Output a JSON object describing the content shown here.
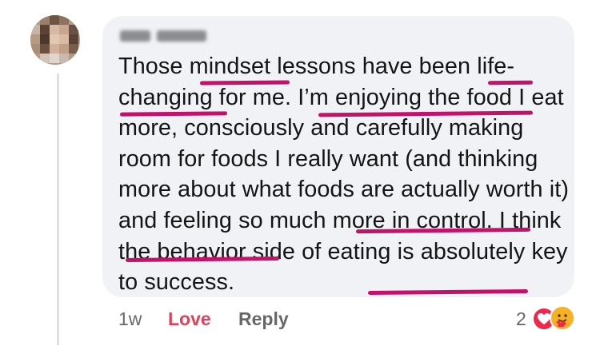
{
  "comment": {
    "author_name": "",
    "paragraph": "Those mindset lessons have been life-changing for me. I’m enjoying the food I eat more, consciously and carefully making room for foods I really want (and thinking more about what foods are actually worth it) and feeling so much more in control. I think the behavior side of eating is absolutely key to success.",
    "underlined_phrases": [
      "mindset",
      "life-changing",
      "I’m enjoying the food",
      "feeling so much more in control",
      "key to success"
    ],
    "underline_color": "#c4126b"
  },
  "actions": {
    "timestamp": "1w",
    "love_label": "Love",
    "reply_label": "Reply"
  },
  "reactions": {
    "count": "2",
    "icons": [
      "love-heart-icon",
      "care-hug-icon"
    ]
  },
  "colors": {
    "bubble_bg": "#f0f2f5",
    "text": "#141414",
    "secondary": "#65676b",
    "love": "#e0405a"
  }
}
